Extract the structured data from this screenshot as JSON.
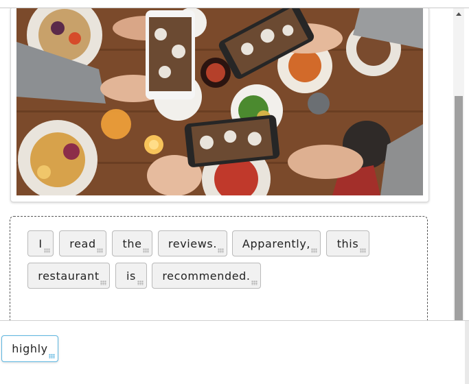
{
  "exercise": {
    "image_alt": "Friends photographing a table of food with smartphones",
    "placed_words": [
      "I",
      "read",
      "the",
      "reviews.",
      "Apparently,",
      "this",
      "restaurant",
      "is",
      "recommended."
    ],
    "tray_words": [
      "highly"
    ]
  },
  "colors": {
    "word_bg": "#f1f1f1",
    "word_border": "#b9b9b9",
    "active_border": "#5bb5e0",
    "scroll_thumb": "#a0a0a0"
  }
}
